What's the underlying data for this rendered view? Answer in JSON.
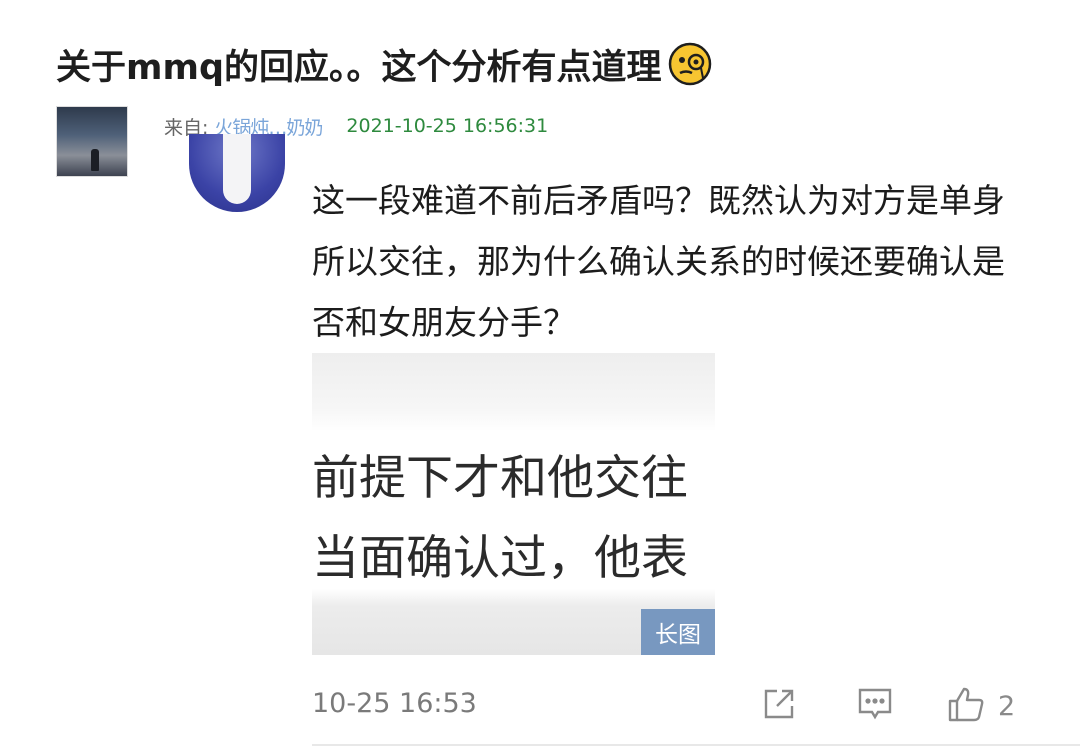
{
  "post": {
    "title": "关于mmq的回应。。这个分析有点道理",
    "title_emoji": "thinking-monocle-face-icon"
  },
  "source": {
    "label": "来自:",
    "name": "火锅炖…奶奶",
    "timestamp": "2021-10-25 16:56:31"
  },
  "comment": {
    "text": "这一段难道不前后矛盾吗？既然认为对方是单身所以交往，那为什么确认关系的时候还要确认是否和女朋友分手？",
    "image": {
      "line1": "前提下才和他交往",
      "line2": "当面确认过，他表",
      "badge": "长图"
    },
    "time": "10-25 16:53",
    "like_count": "2"
  },
  "colors": {
    "timestamp_green": "#2e8a3e",
    "badge_blue": "#7898c0",
    "muted_gray": "#8a8a8a"
  }
}
